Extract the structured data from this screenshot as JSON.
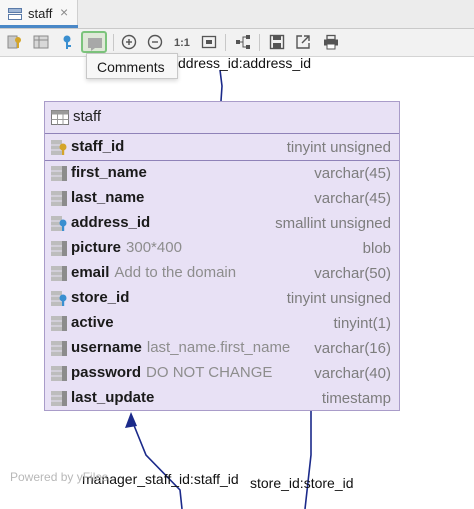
{
  "tab": {
    "title": "staff",
    "close_glyph": "×",
    "icon": "diagram-icon"
  },
  "toolbar": {
    "buttons": [
      {
        "name": "key-columns-icon",
        "tooltip": ""
      },
      {
        "name": "columns-icon",
        "tooltip": ""
      },
      {
        "name": "key-icon",
        "tooltip": ""
      },
      {
        "name": "comment-icon",
        "tooltip": "Comments",
        "active": true
      },
      {
        "name": "zoom-in-icon"
      },
      {
        "name": "zoom-out-icon"
      },
      {
        "name": "actual-size",
        "label": "1:1"
      },
      {
        "name": "fit-content-icon"
      },
      {
        "name": "layout-icon"
      },
      {
        "name": "save-icon"
      },
      {
        "name": "export-icon"
      },
      {
        "name": "print-icon"
      }
    ],
    "actual_size_label": "1:1"
  },
  "tooltip": {
    "text": "Comments"
  },
  "edges": {
    "top_label": "ddress_id:address_id",
    "bottom_left_label": "manager_staff_id:staff_id",
    "bottom_right_label": "store_id:store_id"
  },
  "table": {
    "name": "staff",
    "primary_key": {
      "name": "staff_id",
      "comment": "",
      "type": "tinyint unsigned",
      "icon": "primary-key-icon"
    },
    "columns": [
      {
        "name": "first_name",
        "comment": "",
        "type": "varchar(45)",
        "icon": "column-icon"
      },
      {
        "name": "last_name",
        "comment": "",
        "type": "varchar(45)",
        "icon": "column-icon"
      },
      {
        "name": "address_id",
        "comment": "",
        "type": "smallint unsigned",
        "icon": "foreign-key-icon"
      },
      {
        "name": "picture",
        "comment": "300*400",
        "type": "blob",
        "icon": "column-icon"
      },
      {
        "name": "email",
        "comment": "Add to the domain",
        "type": "varchar(50)",
        "icon": "column-icon"
      },
      {
        "name": "store_id",
        "comment": "",
        "type": "tinyint unsigned",
        "icon": "foreign-key-icon"
      },
      {
        "name": "active",
        "comment": "",
        "type": "tinyint(1)",
        "icon": "column-icon"
      },
      {
        "name": "username",
        "comment": "last_name.first_name",
        "type": "varchar(16)",
        "icon": "column-icon"
      },
      {
        "name": "password",
        "comment": "DO NOT CHANGE",
        "type": "varchar(40)",
        "icon": "column-icon"
      },
      {
        "name": "last_update",
        "comment": "",
        "type": "timestamp",
        "icon": "column-icon"
      }
    ]
  },
  "footer": {
    "powered": "Powered by yFiles"
  },
  "colors": {
    "node_bg": "#e8e1f5",
    "node_border": "#a99cc9",
    "edge": "#1b2a8a",
    "accent": "#4a88c7",
    "key_gold": "#d4a52a",
    "fk_blue": "#3a8fd0"
  }
}
